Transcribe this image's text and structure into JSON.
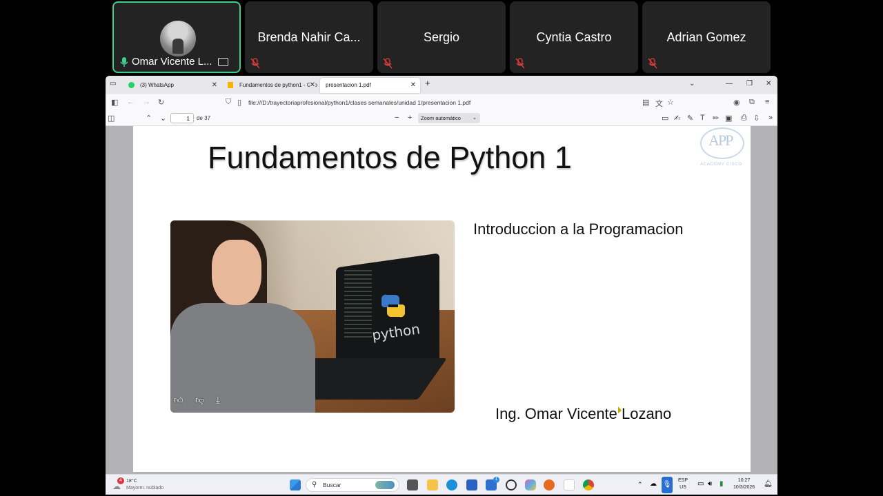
{
  "meeting": {
    "self": {
      "name": "Omar Vicente L..."
    },
    "participants": [
      {
        "name": "Brenda Nahir Ca..."
      },
      {
        "name": "Sergio"
      },
      {
        "name": "Cyntia Castro"
      },
      {
        "name": "Adrian Gomez"
      }
    ]
  },
  "browser": {
    "tabs": [
      {
        "label": "(3) WhatsApp",
        "favicon_color": "#25d366"
      },
      {
        "label": "Fundamentos de python1 - Goo",
        "favicon_color": "#f4b400"
      },
      {
        "label": "presentacion 1.pdf",
        "favicon_color": ""
      }
    ],
    "new_tab": "+",
    "url": "file:///D:/trayectoriaprofesional/python1/clases semanales/unidad 1/presentacion 1.pdf",
    "pdf": {
      "page": "1",
      "page_count": "de 37",
      "zoom": "Zoom automático"
    }
  },
  "slide": {
    "title": "Fundamentos de Python 1",
    "subtitle": "Introduccion a la Programacion",
    "author": "Ing. Omar Vicente Lozano",
    "logo": {
      "letters": "APP",
      "caption": "ACADEMY CISCO"
    },
    "image_text": "python"
  },
  "taskbar": {
    "weather": {
      "badge": "4",
      "temp": "18°C",
      "desc": "Mayorm. nublado"
    },
    "search_placeholder": "Buscar",
    "lang": {
      "top": "ESP",
      "bottom": "US"
    },
    "clock": {
      "time": "10:27",
      "date": "10/3/2026"
    },
    "notif_badge": "1"
  },
  "colors": {
    "active_border": "#3ecf8e",
    "tile_bg": "#232323",
    "mute_red": "#e03a3a"
  }
}
